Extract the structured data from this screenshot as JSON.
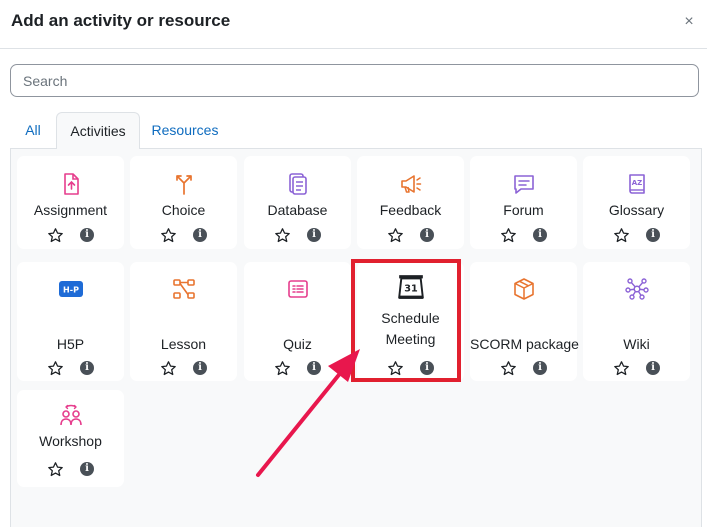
{
  "dialog": {
    "title": "Add an activity or resource",
    "close_label": "×"
  },
  "search": {
    "placeholder": "Search",
    "value": ""
  },
  "tabs": [
    {
      "label": "All",
      "active": false
    },
    {
      "label": "Activities",
      "active": true
    },
    {
      "label": "Resources",
      "active": false
    }
  ],
  "activities": [
    {
      "label": "Assignment",
      "icon": "assignment-icon",
      "color": "#e63e8d"
    },
    {
      "label": "Choice",
      "icon": "choice-icon",
      "color": "#e8742f"
    },
    {
      "label": "Database",
      "icon": "database-icon",
      "color": "#8c63d6"
    },
    {
      "label": "Feedback",
      "icon": "feedback-icon",
      "color": "#e8742f"
    },
    {
      "label": "Forum",
      "icon": "forum-icon",
      "color": "#8c63d6"
    },
    {
      "label": "Glossary",
      "icon": "glossary-icon",
      "color": "#8c63d6"
    },
    {
      "label": "H5P",
      "icon": "h5p-icon",
      "color": "#1e6bd6"
    },
    {
      "label": "Lesson",
      "icon": "lesson-icon",
      "color": "#e8742f"
    },
    {
      "label": "Quiz",
      "icon": "quiz-icon",
      "color": "#e63e8d"
    },
    {
      "label": "Schedule Meeting",
      "icon": "calendar-icon",
      "color": "#1d2125"
    },
    {
      "label": "SCORM package",
      "icon": "scorm-package-icon",
      "color": "#e8742f"
    },
    {
      "label": "Wiki",
      "icon": "wiki-icon",
      "color": "#8c63d6"
    },
    {
      "label": "Workshop",
      "icon": "workshop-icon",
      "color": "#e63e8d"
    }
  ],
  "calendar_icon_text": "31",
  "h5p_icon_text": "H-P",
  "info_glyph": "i",
  "annotation": {
    "highlight_color": "#e1202f",
    "arrow_color": "#e8174d"
  }
}
